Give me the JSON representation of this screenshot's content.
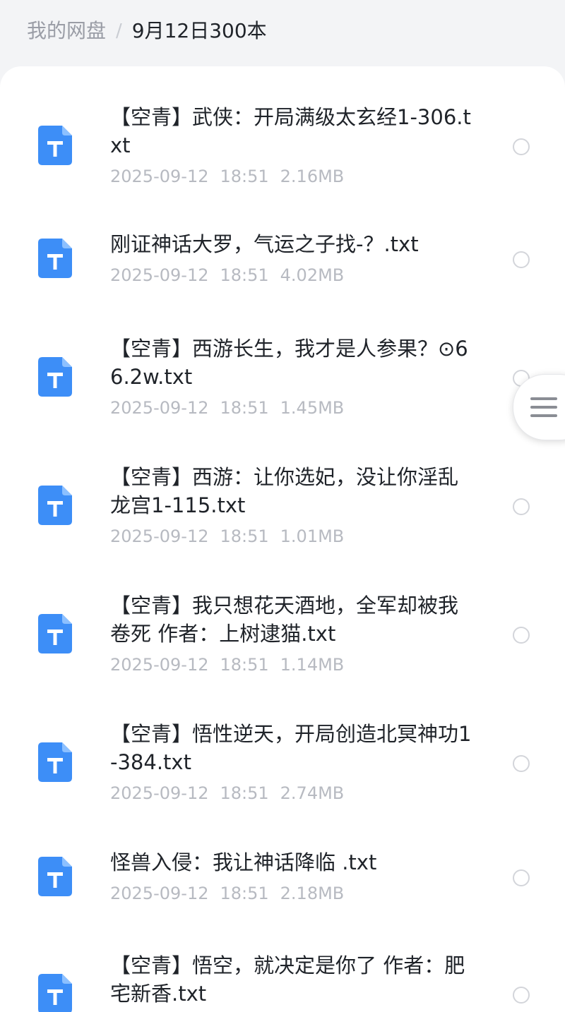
{
  "breadcrumb": {
    "root": "我的网盘",
    "separator": "/",
    "current": "9月12日300本"
  },
  "colors": {
    "icon_blue": "#3d8ef7",
    "text_primary": "#1f2329",
    "text_meta": "#b7bac1"
  },
  "files": [
    {
      "name": "【空青】武侠：开局满级太玄经1-306.txt",
      "date": "2025-09-12",
      "time": "18:51",
      "size": "2.16MB",
      "icon": "txt-file-icon"
    },
    {
      "name": "刚证神话大罗，气运之子找-？.txt",
      "date": "2025-09-12",
      "time": "18:51",
      "size": "4.02MB",
      "icon": "txt-file-icon"
    },
    {
      "name": "【空青】西游长生，我才是人参果？⊙66.2w.txt",
      "date": "2025-09-12",
      "time": "18:51",
      "size": "1.45MB",
      "icon": "txt-file-icon"
    },
    {
      "name": "【空青】西游：让你选妃，没让你淫乱龙宫1-115.txt",
      "date": "2025-09-12",
      "time": "18:51",
      "size": "1.01MB",
      "icon": "txt-file-icon"
    },
    {
      "name": "【空青】我只想花天酒地，全军却被我卷死 作者：上树逮猫.txt",
      "date": "2025-09-12",
      "time": "18:51",
      "size": "1.14MB",
      "icon": "txt-file-icon"
    },
    {
      "name": "【空青】悟性逆天，开局创造北冥神功1-384.txt",
      "date": "2025-09-12",
      "time": "18:51",
      "size": "2.74MB",
      "icon": "txt-file-icon"
    },
    {
      "name": "怪兽入侵：我让神话降临 .txt",
      "date": "2025-09-12",
      "time": "18:51",
      "size": "2.18MB",
      "icon": "txt-file-icon"
    },
    {
      "name": "【空青】悟空，就决定是你了 作者：肥宅新香.txt",
      "date": "",
      "time": "",
      "size": "",
      "icon": "txt-file-icon"
    }
  ],
  "floating_menu": {
    "icon": "hamburger-menu-icon"
  }
}
